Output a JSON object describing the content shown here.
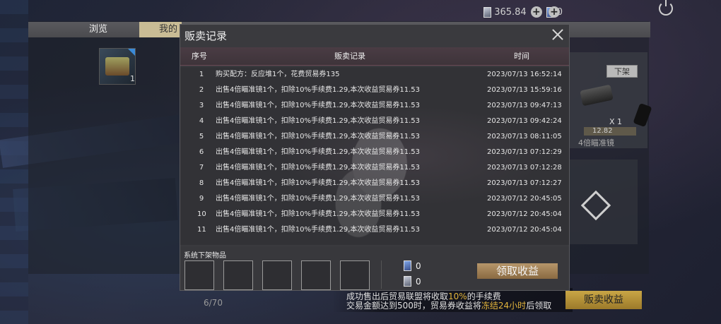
{
  "topbar": {
    "silver_coupon": "365.84",
    "blue_coupon": "0",
    "plus": "+"
  },
  "tabs": {
    "browse": "浏览",
    "mine": "我的"
  },
  "background_items": {
    "item_count": "1",
    "unlist_label": "下架",
    "quantity": "X 1",
    "price": "12.82",
    "item_name": "4倍瞄准镜"
  },
  "dialog": {
    "title": "贩卖记录",
    "headers": {
      "index": "序号",
      "record": "贩卖记录",
      "time": "时间"
    },
    "rows": [
      {
        "idx": "1",
        "record": "购买配方：反应堆1个，花费贸易券135",
        "time": "2023/07/13 16:52:14"
      },
      {
        "idx": "2",
        "record": "出售4倍瞄准镜1个，扣除10%手续费1.29,本次收益贸易券11.53",
        "time": "2023/07/13 15:59:16"
      },
      {
        "idx": "3",
        "record": "出售4倍瞄准镜1个，扣除10%手续费1.29,本次收益贸易券11.53",
        "time": "2023/07/13 09:47:13"
      },
      {
        "idx": "4",
        "record": "出售4倍瞄准镜1个，扣除10%手续费1.29,本次收益贸易券11.53",
        "time": "2023/07/13 09:42:24"
      },
      {
        "idx": "5",
        "record": "出售4倍瞄准镜1个，扣除10%手续费1.29,本次收益贸易券11.53",
        "time": "2023/07/13 08:11:05"
      },
      {
        "idx": "6",
        "record": "出售4倍瞄准镜1个，扣除10%手续费1.29,本次收益贸易券11.53",
        "time": "2023/07/13 07:12:29"
      },
      {
        "idx": "7",
        "record": "出售4倍瞄准镜1个，扣除10%手续费1.29,本次收益贸易券11.53",
        "time": "2023/07/13 07:12:28"
      },
      {
        "idx": "8",
        "record": "出售4倍瞄准镜1个，扣除10%手续费1.29,本次收益贸易券11.53",
        "time": "2023/07/13 07:12:27"
      },
      {
        "idx": "9",
        "record": "出售4倍瞄准镜1个，扣除10%手续费1.29,本次收益贸易券11.53",
        "time": "2023/07/12 20:45:05"
      },
      {
        "idx": "10",
        "record": "出售4倍瞄准镜1个，扣除10%手续费1.29,本次收益贸易券11.53",
        "time": "2023/07/12 20:45:04"
      },
      {
        "idx": "11",
        "record": "出售4倍瞄准镜1个，扣除10%手续费1.29,本次收益贸易券11.53",
        "time": "2023/07/12 20:45:04"
      }
    ],
    "system_unlisted_label": "系统下架物品",
    "reward_blue": "0",
    "reward_silver": "0",
    "claim_label": "领取收益"
  },
  "footer": {
    "page_count": "6/70",
    "fee_line1_pre": "成功售出后贸易联盟将收取",
    "fee_line1_hl": "10%",
    "fee_line1_post": "的手续费",
    "fee_line2_pre": "交易金额达到500时，贸易券收益将",
    "fee_line2_hl": "冻结24小时",
    "fee_line2_post": "后领取",
    "sell_income_label": "贩卖收益"
  }
}
